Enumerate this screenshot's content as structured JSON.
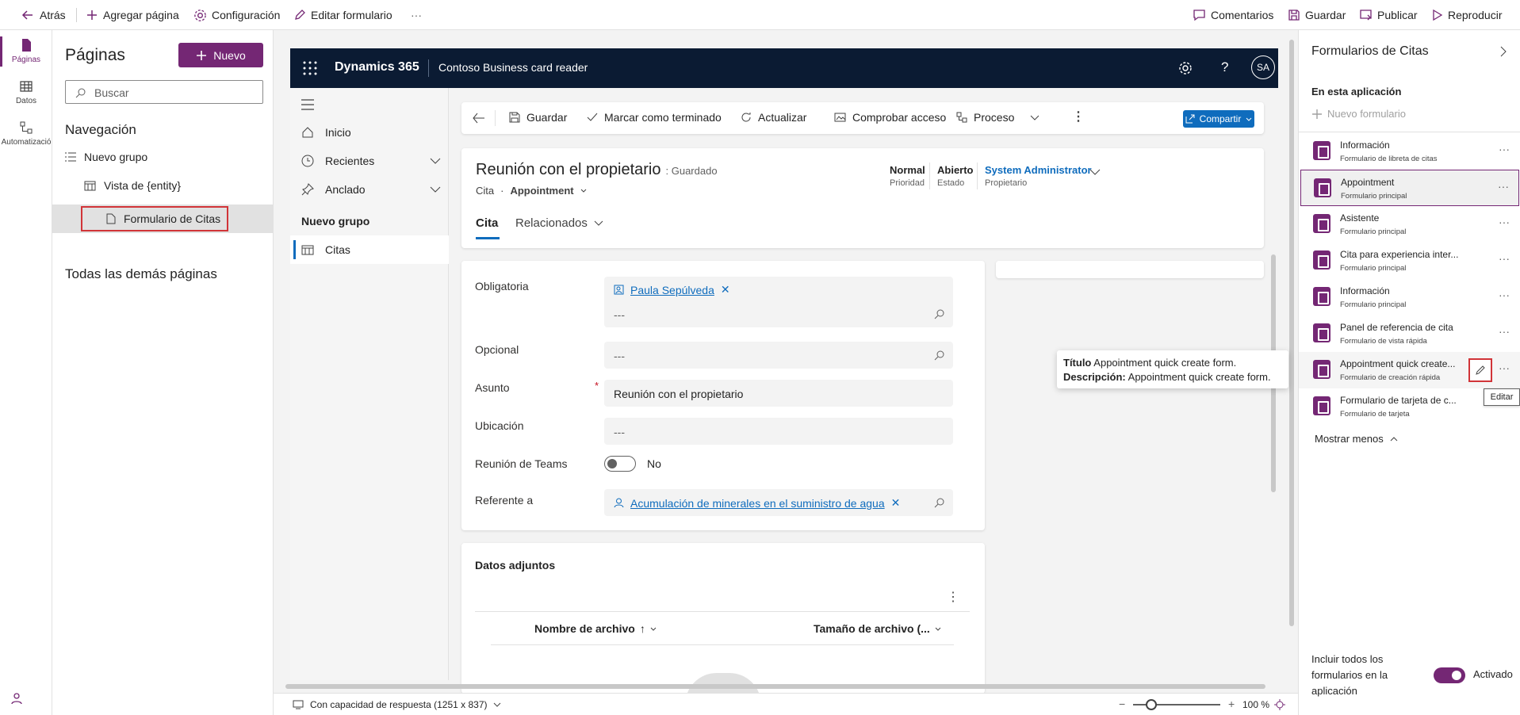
{
  "topbar": {
    "back": "Atrás",
    "add_page": "Agregar página",
    "settings": "Configuración",
    "edit_form": "Editar formulario",
    "more": "···",
    "comments": "Comentarios",
    "save": "Guardar",
    "publish": "Publicar",
    "play": "Reproducir"
  },
  "rail": {
    "pages": "Páginas",
    "data": "Datos",
    "automation": "Automatizació"
  },
  "pages_panel": {
    "title": "Páginas",
    "new_button": "Nuevo",
    "search_placeholder": "Buscar",
    "navigation_heading": "Navegación",
    "group": "Nuevo grupo",
    "view_item": "Vista de {entity}",
    "form_item": "Formulario de Citas",
    "other_pages": "Todas las demás páginas"
  },
  "app": {
    "brand": "Dynamics 365",
    "app_name": "Contoso Business card reader",
    "avatar": "SA",
    "nav": {
      "home": "Inicio",
      "recent": "Recientes",
      "pinned": "Anclado",
      "group": "Nuevo grupo",
      "citas": "Citas"
    },
    "commands": {
      "save": "Guardar",
      "mark_complete": "Marcar como terminado",
      "refresh": "Actualizar",
      "check_access": "Comprobar acceso",
      "process": "Proceso",
      "share": "Compartir"
    },
    "header": {
      "title": "Reunión con el propietario",
      "status": ": Guardado",
      "entity": "Cita",
      "dot": "·",
      "form_selector": "Appointment",
      "priority_value": "Normal",
      "priority_label": "Prioridad",
      "state_value": "Abierto",
      "state_label": "Estado",
      "owner_value": "System Administrator",
      "owner_label": "Propietario"
    },
    "tabs": {
      "cita": "Cita",
      "related": "Relacionados"
    },
    "fields": {
      "required_label": "Obligatoria",
      "required_value": "Paula Sepúlveda",
      "empty": "---",
      "optional_label": "Opcional",
      "subject_label": "Asunto",
      "subject_value": "Reunión con el propietario",
      "asterisk": "*",
      "location_label": "Ubicación",
      "teams_label": "Reunión de Teams",
      "teams_value": "No",
      "regarding_label": "Referente a",
      "regarding_value": "Acumulación de minerales en el suministro de agua"
    },
    "attachments": {
      "title": "Datos adjuntos",
      "col_name": "Nombre de archivo",
      "col_size": "Tamaño de archivo (..."
    }
  },
  "tooltip": {
    "title_label": "Título",
    "title_value": "Appointment quick create form.",
    "desc_label": "Descripción:",
    "desc_value": "Appointment quick create form."
  },
  "bottom": {
    "responsive": "Con capacidad de respuesta (1251 x 837)",
    "zoom": "100 %",
    "minus": "−",
    "plus": "+"
  },
  "right_panel": {
    "title": "Formularios de Citas",
    "section": "En esta aplicación",
    "new_form": "Nuevo formulario",
    "forms": [
      {
        "name": "Información",
        "type": "Formulario de libreta de citas"
      },
      {
        "name": "Appointment",
        "type": "Formulario principal"
      },
      {
        "name": "Asistente",
        "type": "Formulario principal"
      },
      {
        "name": "Cita para experiencia inter...",
        "type": "Formulario principal"
      },
      {
        "name": "Información",
        "type": "Formulario principal"
      },
      {
        "name": "Panel de referencia de cita",
        "type": "Formulario de vista rápida"
      },
      {
        "name": "Appointment quick create...",
        "type": "Formulario de creación rápida"
      },
      {
        "name": "Formulario de tarjeta de c...",
        "type": "Formulario de tarjeta"
      }
    ],
    "more": "···",
    "edit_tooltip": "Editar",
    "show_less": "Mostrar menos",
    "include_all": "Incluir todos los formularios en la aplicación",
    "toggle_state": "Activado"
  }
}
